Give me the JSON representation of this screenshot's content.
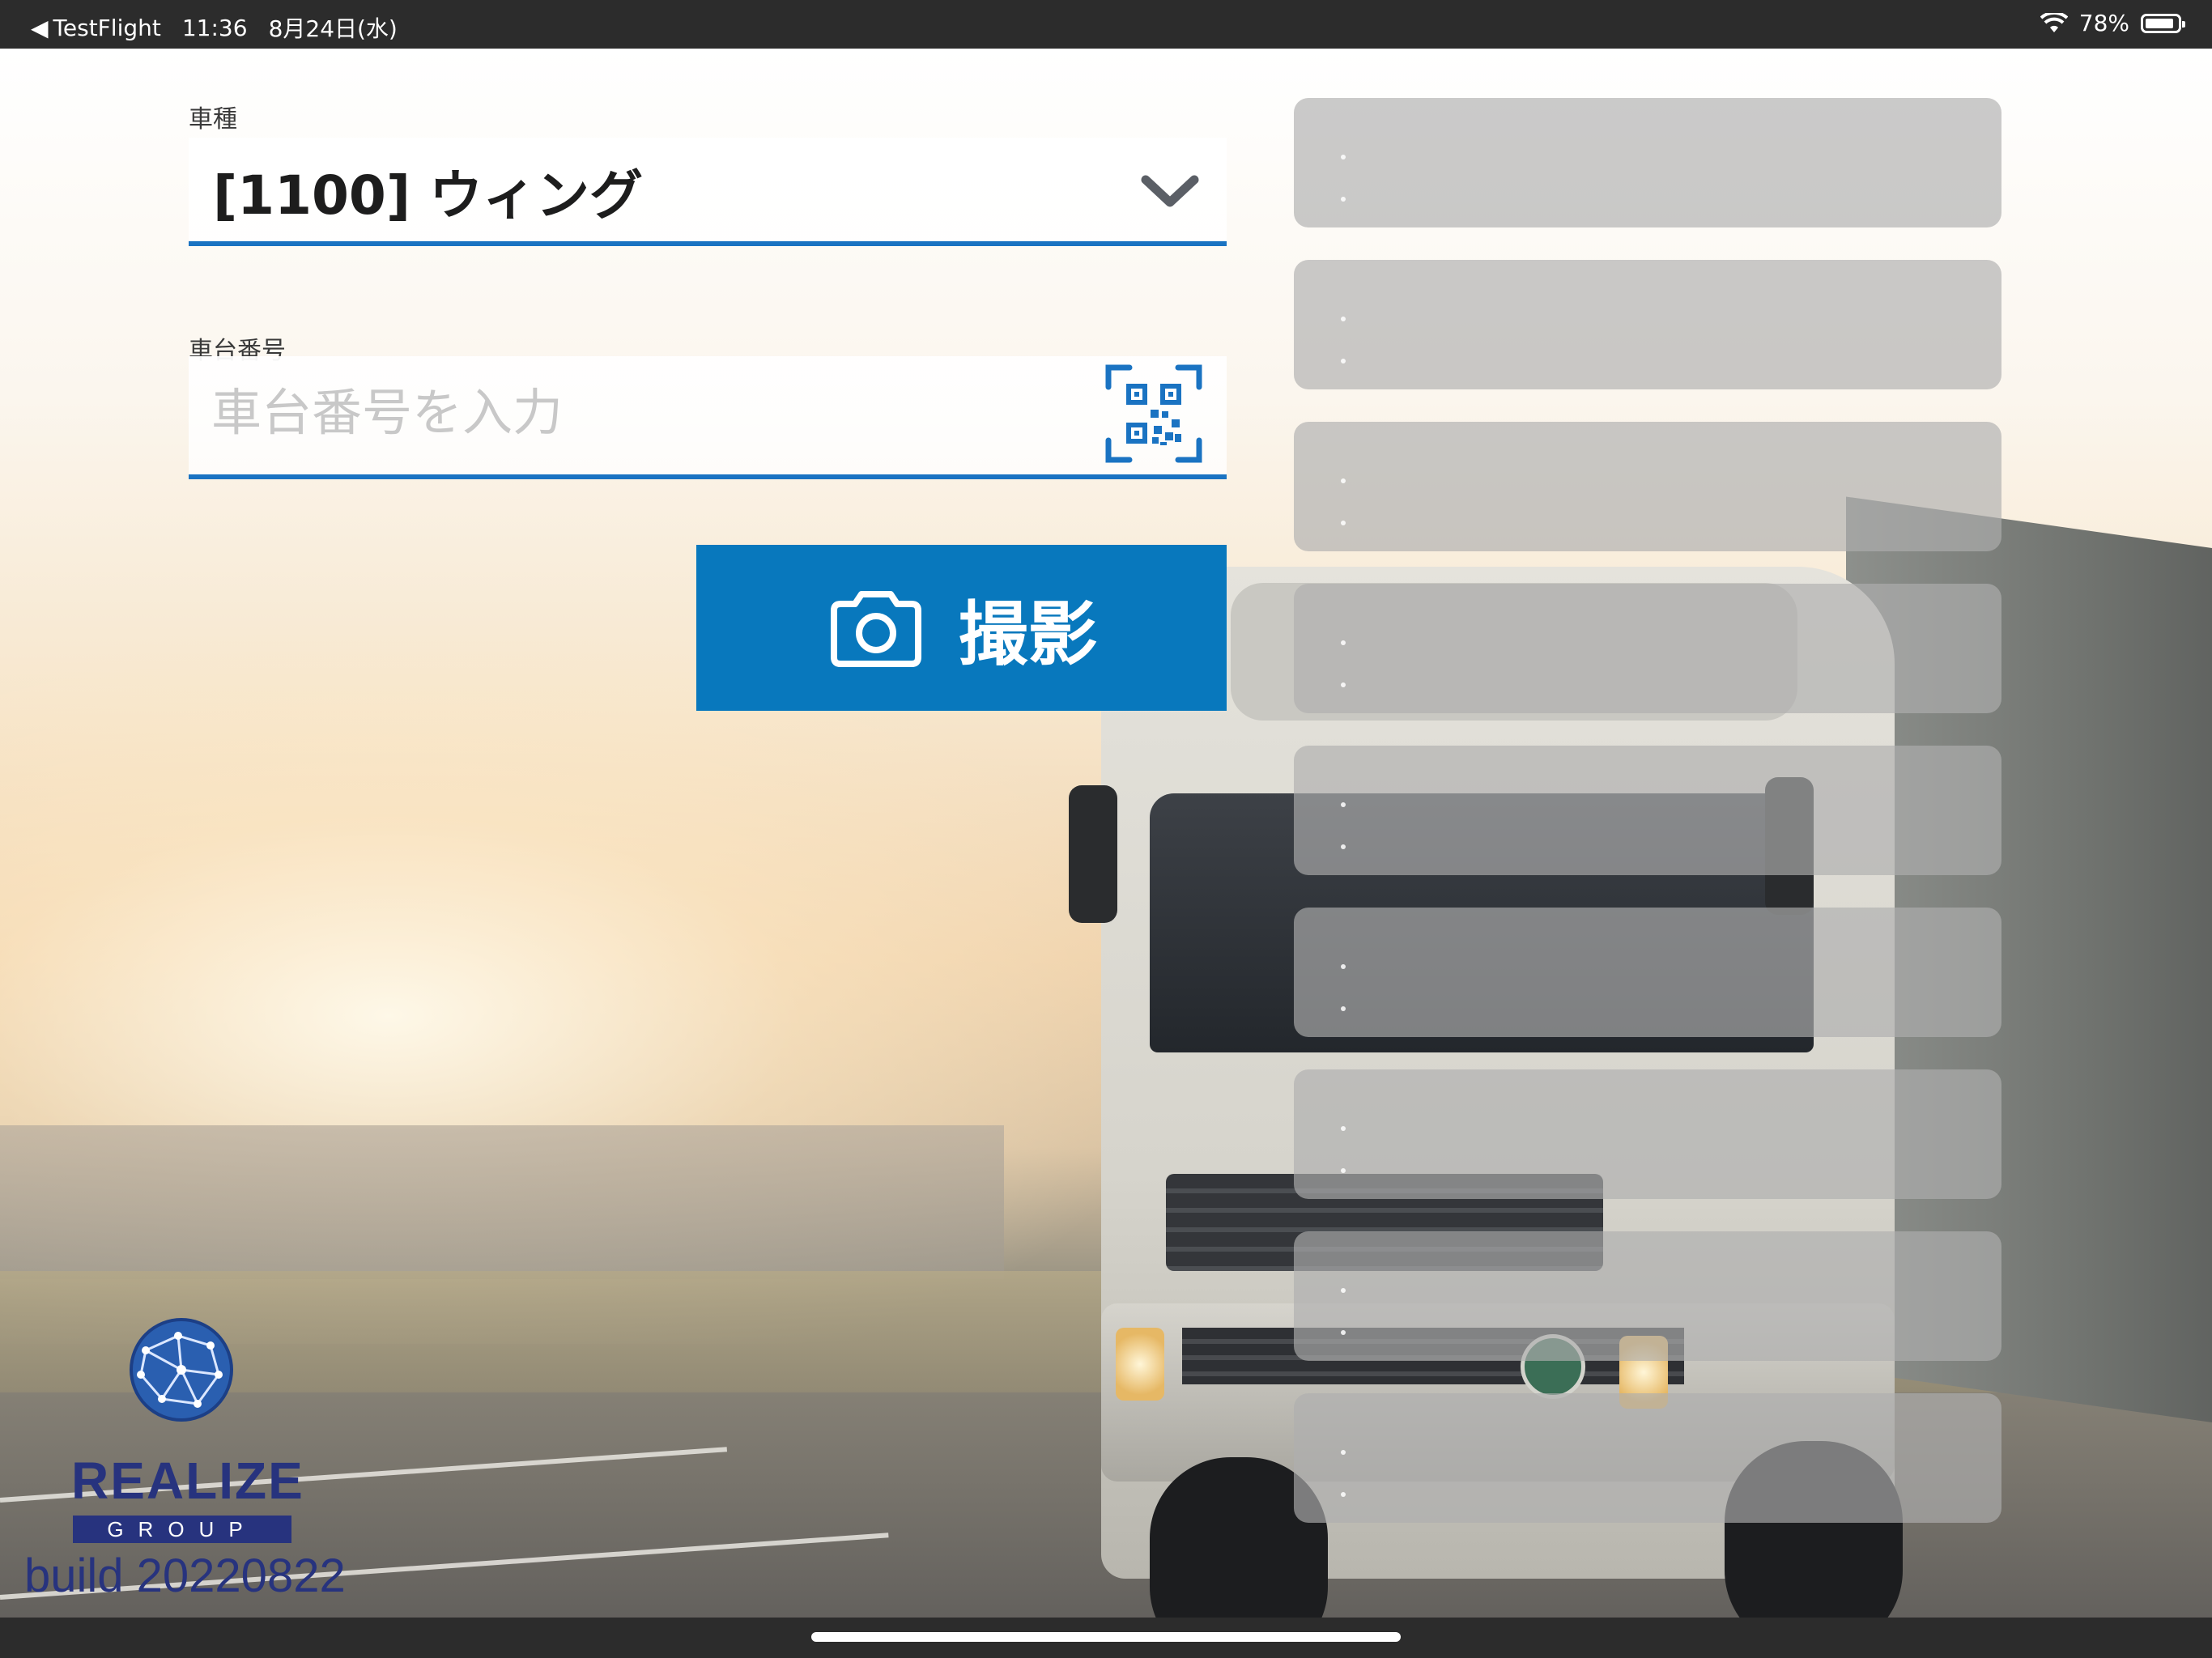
{
  "status_bar": {
    "back_app": "TestFlight",
    "time": "11:36",
    "date": "8月24日(水)",
    "battery": "78%"
  },
  "form": {
    "vehicle_type_label": "車種",
    "vehicle_type_value": "[1100] ウィング",
    "chassis_number_label": "車台番号",
    "chassis_number_placeholder": "車台番号を入力",
    "chassis_number_value": "",
    "shoot_button_label": "撮影"
  },
  "logo": {
    "name": "REALIZE",
    "group": "GROUP",
    "build": "build 20220822"
  },
  "colors": {
    "accent": "#0878bd",
    "underline": "#1a73c2",
    "logo": "#27337e"
  }
}
